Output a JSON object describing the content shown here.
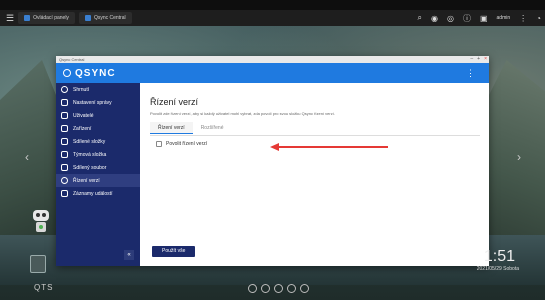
{
  "browser": {
    "tabs": [
      {
        "label": "Ovládací panely"
      },
      {
        "label": "Qsync Central"
      }
    ],
    "user": "admin"
  },
  "window": {
    "title": "Qsync Central",
    "brand": "QSYNC"
  },
  "sidebar": {
    "items": [
      {
        "label": "Shrnutí",
        "icon": "clock-icon"
      },
      {
        "label": "Nastavení správy",
        "icon": "gear-icon"
      },
      {
        "label": "Uživatelé",
        "icon": "users-icon"
      },
      {
        "label": "Zařízení",
        "icon": "device-icon"
      },
      {
        "label": "Sdílené složky",
        "icon": "shared-folder-icon"
      },
      {
        "label": "Týmová složka",
        "icon": "team-folder-icon"
      },
      {
        "label": "Sdílený soubor",
        "icon": "shared-file-icon"
      },
      {
        "label": "Řízení verzí",
        "icon": "version-icon"
      },
      {
        "label": "Záznamy událostí",
        "icon": "log-icon"
      }
    ],
    "active_index": 7
  },
  "content": {
    "title": "Řízení verzí",
    "description": "Povolit zde řízení verzí, aby si každý uživatel mohl vybrat, zda povolí pro svou složku Qsync řízení verzí.",
    "tabs": [
      {
        "label": "Řízení verzí"
      },
      {
        "label": "Rozšířené"
      }
    ],
    "checkbox_label": "Povolit řízení verzí",
    "checkbox_checked": false,
    "apply_label": "Použít vše"
  },
  "desktop": {
    "clock": "1:51",
    "date": "2021/05/29 Sobota",
    "os_label": "QTS"
  },
  "colors": {
    "header_blue": "#1f7ae0",
    "sidebar_navy": "#1b2a6b",
    "arrow_red": "#e53935"
  }
}
